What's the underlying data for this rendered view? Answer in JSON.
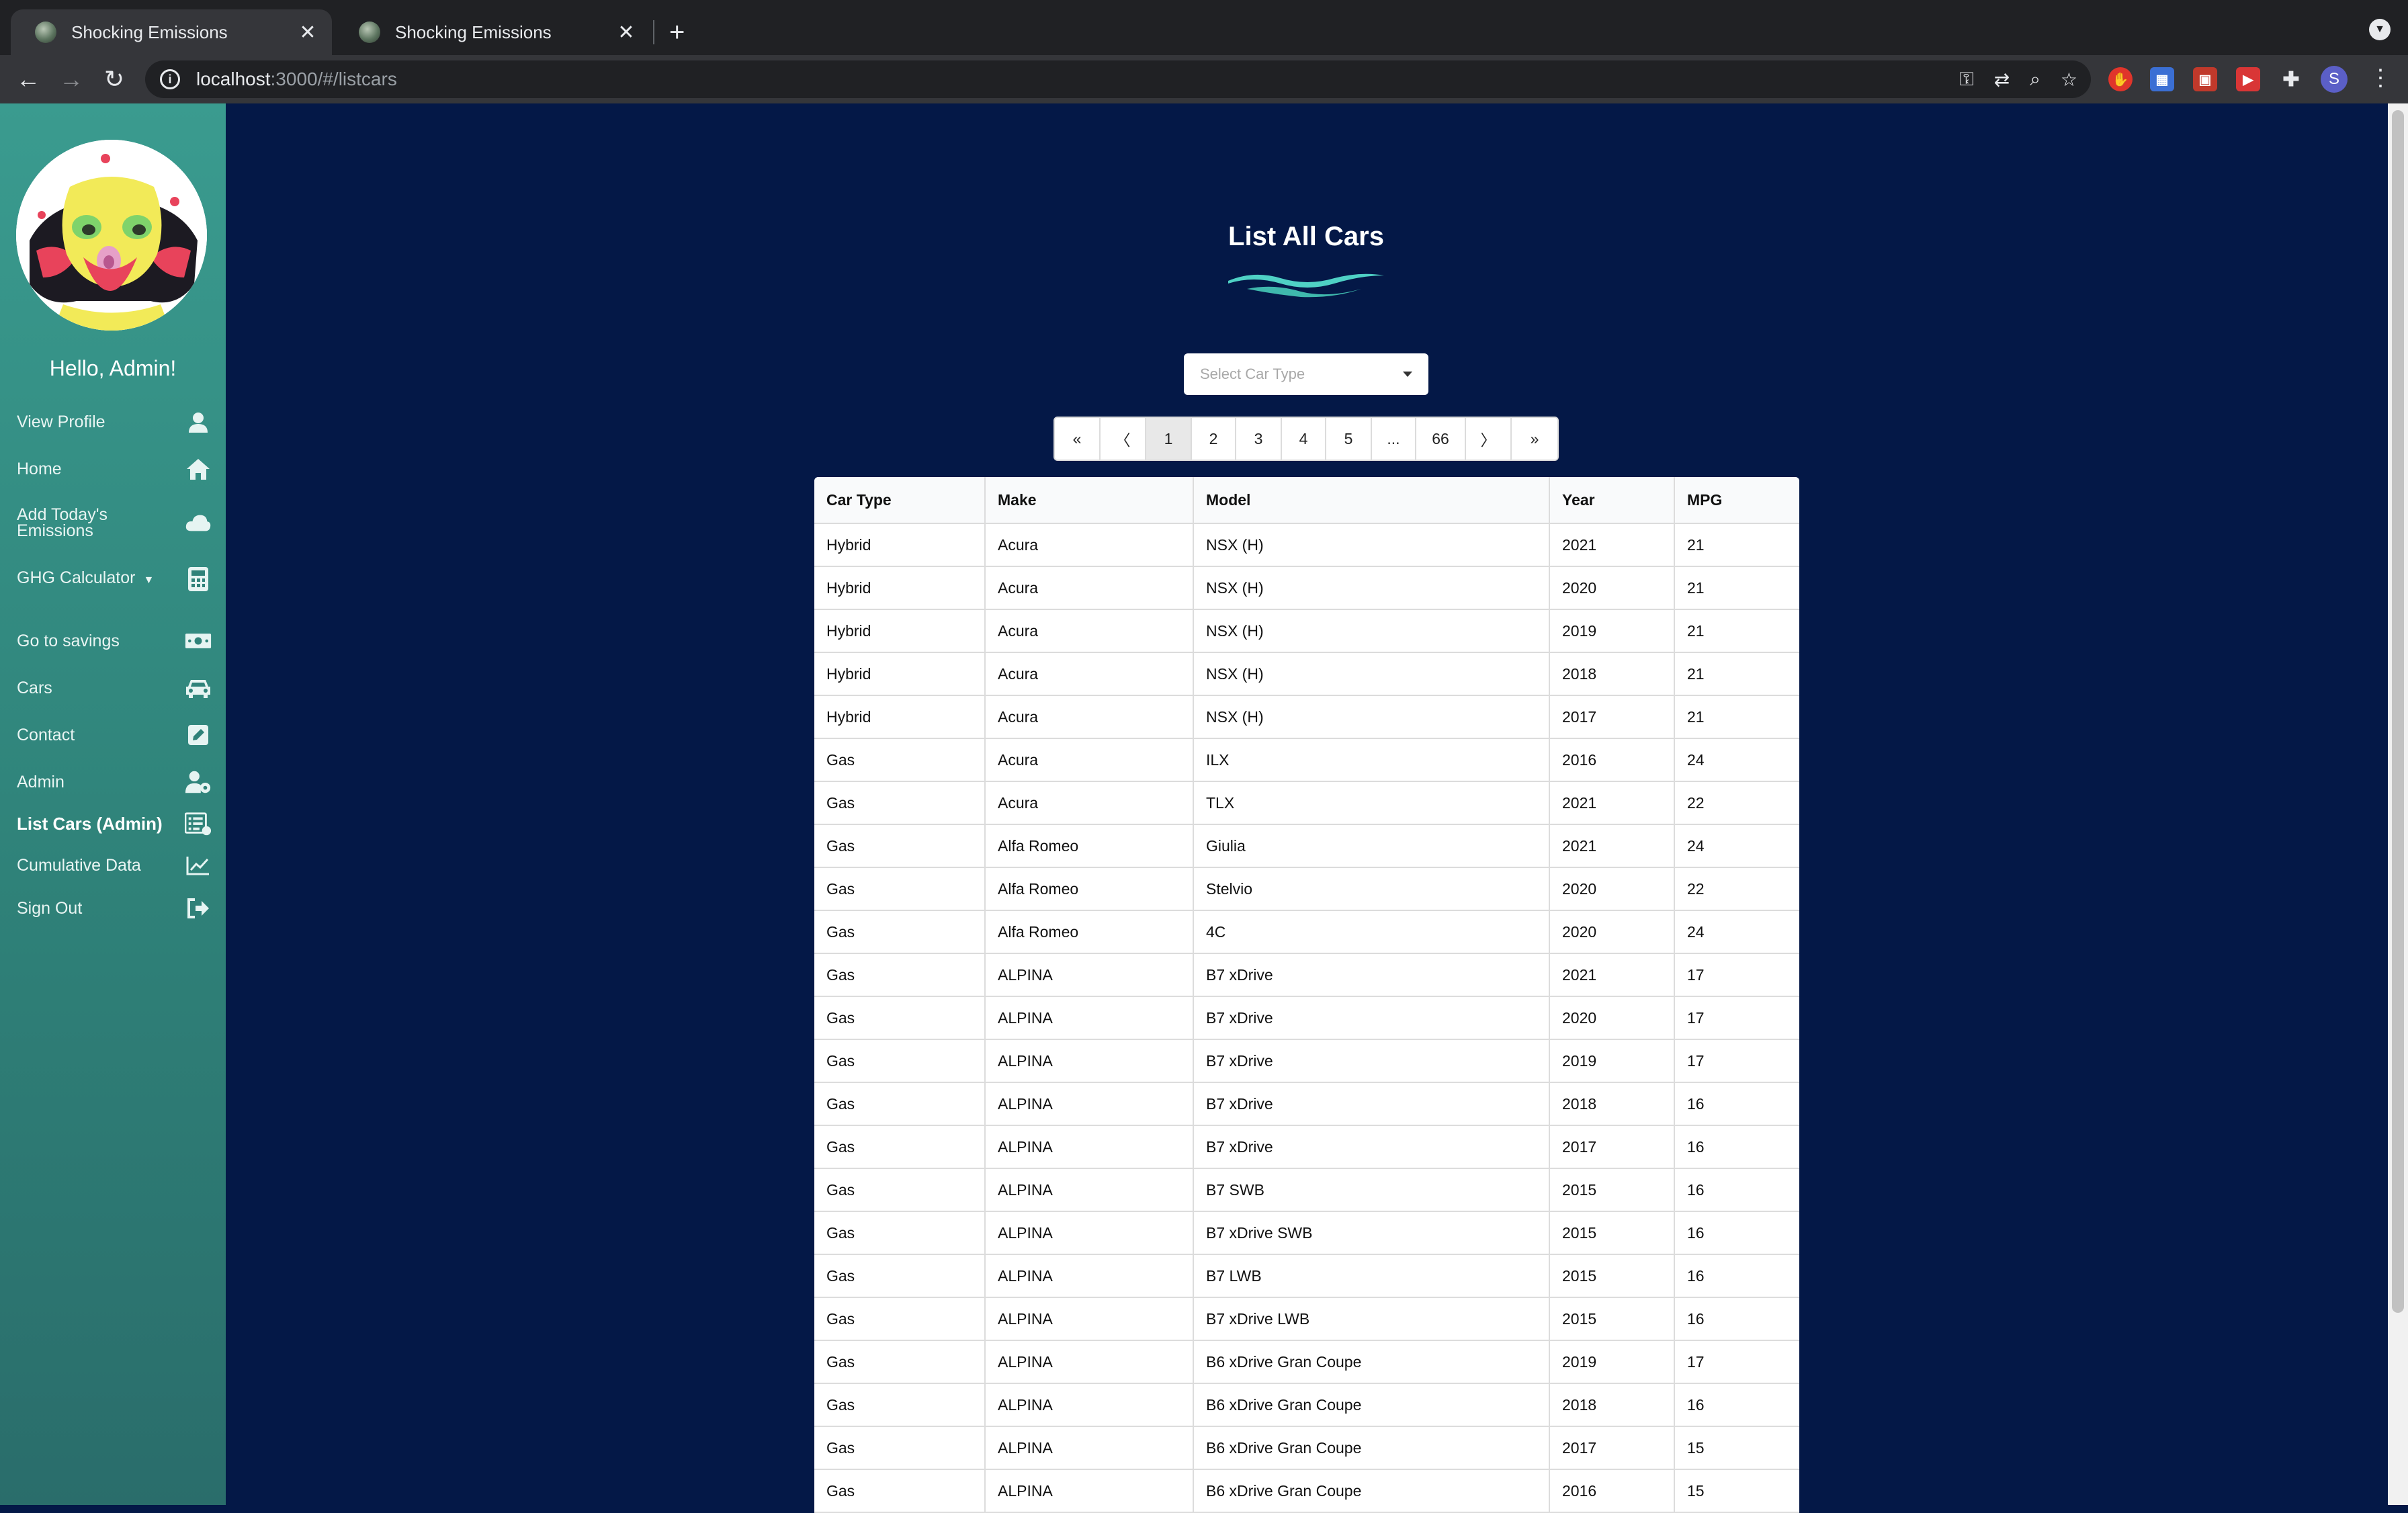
{
  "browser": {
    "tabs": [
      {
        "title": "Shocking Emissions",
        "active": true
      },
      {
        "title": "Shocking Emissions",
        "active": false
      }
    ],
    "url_host": "localhost",
    "url_path": ":3000/#/listcars",
    "profile_initial": "S"
  },
  "sidebar": {
    "greeting": "Hello, Admin!",
    "items": [
      {
        "label": "View Profile",
        "icon": "user-icon"
      },
      {
        "label": "Home",
        "icon": "home-icon"
      },
      {
        "label": "Add Today's Emissions",
        "icon": "cloud-icon"
      },
      {
        "label": "GHG Calculator",
        "icon": "calculator-icon"
      },
      {
        "label": "Go to savings",
        "icon": "money-icon"
      },
      {
        "label": "Cars",
        "icon": "car-icon"
      },
      {
        "label": "Contact",
        "icon": "edit-icon"
      },
      {
        "label": "Admin",
        "icon": "user-cog-icon"
      },
      {
        "label": "List Cars (Admin)",
        "icon": "list-icon",
        "active": true
      },
      {
        "label": "Cumulative Data",
        "icon": "chart-line-icon"
      },
      {
        "label": "Sign Out",
        "icon": "sign-out-icon"
      }
    ]
  },
  "main": {
    "title": "List All Cars",
    "select_placeholder": "Select Car Type",
    "pagination": [
      "«",
      "〈",
      "1",
      "2",
      "3",
      "4",
      "5",
      "...",
      "66",
      "〉",
      "»"
    ],
    "active_page": "1",
    "table": {
      "headers": [
        "Car Type",
        "Make",
        "Model",
        "Year",
        "MPG"
      ],
      "rows": [
        [
          "Hybrid",
          "Acura",
          "NSX (H)",
          "2021",
          "21"
        ],
        [
          "Hybrid",
          "Acura",
          "NSX (H)",
          "2020",
          "21"
        ],
        [
          "Hybrid",
          "Acura",
          "NSX (H)",
          "2019",
          "21"
        ],
        [
          "Hybrid",
          "Acura",
          "NSX (H)",
          "2018",
          "21"
        ],
        [
          "Hybrid",
          "Acura",
          "NSX (H)",
          "2017",
          "21"
        ],
        [
          "Gas",
          "Acura",
          "ILX",
          "2016",
          "24"
        ],
        [
          "Gas",
          "Acura",
          "TLX",
          "2021",
          "22"
        ],
        [
          "Gas",
          "Alfa Romeo",
          "Giulia",
          "2021",
          "24"
        ],
        [
          "Gas",
          "Alfa Romeo",
          "Stelvio",
          "2020",
          "22"
        ],
        [
          "Gas",
          "Alfa Romeo",
          "4C",
          "2020",
          "24"
        ],
        [
          "Gas",
          "ALPINA",
          "B7 xDrive",
          "2021",
          "17"
        ],
        [
          "Gas",
          "ALPINA",
          "B7 xDrive",
          "2020",
          "17"
        ],
        [
          "Gas",
          "ALPINA",
          "B7 xDrive",
          "2019",
          "17"
        ],
        [
          "Gas",
          "ALPINA",
          "B7 xDrive",
          "2018",
          "16"
        ],
        [
          "Gas",
          "ALPINA",
          "B7 xDrive",
          "2017",
          "16"
        ],
        [
          "Gas",
          "ALPINA",
          "B7 SWB",
          "2015",
          "16"
        ],
        [
          "Gas",
          "ALPINA",
          "B7 xDrive SWB",
          "2015",
          "16"
        ],
        [
          "Gas",
          "ALPINA",
          "B7 LWB",
          "2015",
          "16"
        ],
        [
          "Gas",
          "ALPINA",
          "B7 xDrive LWB",
          "2015",
          "16"
        ],
        [
          "Gas",
          "ALPINA",
          "B6 xDrive Gran Coupe",
          "2019",
          "17"
        ],
        [
          "Gas",
          "ALPINA",
          "B6 xDrive Gran Coupe",
          "2018",
          "16"
        ],
        [
          "Gas",
          "ALPINA",
          "B6 xDrive Gran Coupe",
          "2017",
          "15"
        ],
        [
          "Gas",
          "ALPINA",
          "B6 xDrive Gran Coupe",
          "2016",
          "15"
        ]
      ]
    }
  },
  "colors": {
    "main_bg": "#041847",
    "sidebar_top": "#3a9b8f",
    "sidebar_bottom": "#2a6d6b",
    "wave_accent": "#4fd1c5"
  }
}
